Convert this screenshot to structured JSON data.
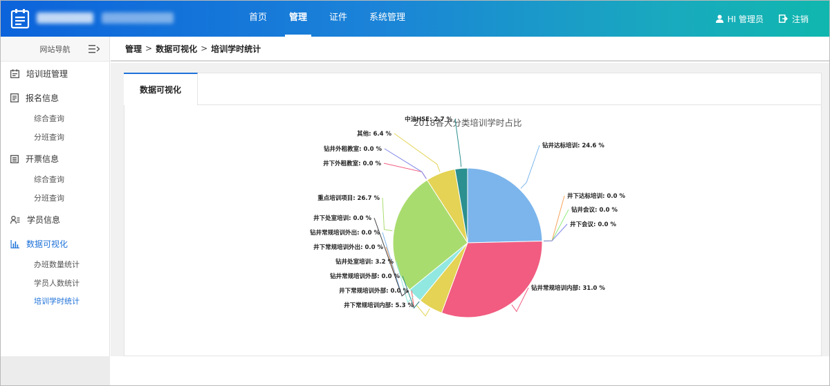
{
  "header": {
    "nav": [
      {
        "label": "首页",
        "active": false
      },
      {
        "label": "管理",
        "active": true
      },
      {
        "label": "证件",
        "active": false
      },
      {
        "label": "系统管理",
        "active": false
      }
    ],
    "user_label": "HI 管理员",
    "logout_label": "注销"
  },
  "sidebar": {
    "title": "网站导航",
    "groups": [
      {
        "label": "培训班管理",
        "icon": "calendar-icon",
        "subs": []
      },
      {
        "label": "报名信息",
        "icon": "document-icon",
        "subs": [
          "综合查询",
          "分班查询"
        ]
      },
      {
        "label": "开票信息",
        "icon": "invoice-icon",
        "subs": [
          "综合查询",
          "分班查询"
        ]
      },
      {
        "label": "学员信息",
        "icon": "user-list-icon",
        "subs": []
      },
      {
        "label": "数据可视化",
        "icon": "bar-chart-icon",
        "active": true,
        "subs": [
          "办班数量统计",
          "学员人数统计",
          "培训学时统计"
        ],
        "active_sub": "培训学时统计"
      }
    ]
  },
  "breadcrumb": [
    "管理",
    "数据可视化",
    "培训学时统计"
  ],
  "breadcrumb_sep": ">",
  "tab_label": "数据可视化",
  "chart_data": {
    "type": "pie",
    "title": "2018各大分类培训学时占比",
    "slices": [
      {
        "name": "钻井达标培训",
        "value": 24.6,
        "color": "#7cb5ec"
      },
      {
        "name": "井下达标培训",
        "value": 0.0,
        "color": "#f7a35c"
      },
      {
        "name": "钻井会议",
        "value": 0.0,
        "color": "#90ed7d"
      },
      {
        "name": "井下会议",
        "value": 0.0,
        "color": "#8085e9"
      },
      {
        "name": "钻井常规培训内部",
        "value": 31.0,
        "color": "#f15c80"
      },
      {
        "name": "井下常规培训内部",
        "value": 5.3,
        "color": "#e4d354"
      },
      {
        "name": "井下常规培训外部",
        "value": 0.0,
        "color": "#f45b5b"
      },
      {
        "name": "钻井常规培训外部",
        "value": 0.0,
        "color": "#2b908f"
      },
      {
        "name": "钻井处室培训",
        "value": 3.2,
        "color": "#91e8e1"
      },
      {
        "name": "井下常规培训外出",
        "value": 0.0,
        "color": "#f7a35c"
      },
      {
        "name": "钻井常规培训外出",
        "value": 0.0,
        "color": "#7cb5ec"
      },
      {
        "name": "井下处室培训",
        "value": 0.0,
        "color": "#434348"
      },
      {
        "name": "重点培训项目",
        "value": 26.7,
        "color": "#a9dc6e"
      },
      {
        "name": "井下外租教室",
        "value": 0.0,
        "color": "#f15c80"
      },
      {
        "name": "钻井外租教室",
        "value": 0.0,
        "color": "#8085e9"
      },
      {
        "name": "其他",
        "value": 6.4,
        "color": "#e4d354"
      },
      {
        "name": "中油HSE",
        "value": 2.7,
        "color": "#2b908f"
      }
    ],
    "label_suffix": " %",
    "legend": "none"
  }
}
